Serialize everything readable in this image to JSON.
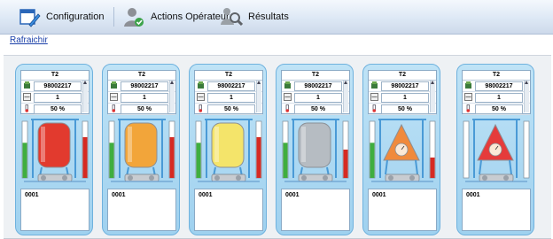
{
  "toolbar": {
    "tabs": [
      {
        "label": "Configuration",
        "icon": "configuration-icon"
      },
      {
        "label": "Actions Opérateur",
        "icon": "operator-icon"
      },
      {
        "label": "Résultats",
        "icon": "search-results-icon"
      }
    ]
  },
  "refresh_label": "Rafraichir",
  "tanks": [
    {
      "title": "T2",
      "lot": "98002217",
      "count": "1",
      "percent": "50 %",
      "code": "0001",
      "shape": "cylinder",
      "color": "#e23a2e",
      "left_level": 0.62,
      "right_level": 0.72
    },
    {
      "title": "T2",
      "lot": "98002217",
      "count": "1",
      "percent": "50 %",
      "code": "0001",
      "shape": "cylinder",
      "color": "#f2a53a",
      "left_level": 0.62,
      "right_level": 0.72
    },
    {
      "title": "T2",
      "lot": "98002217",
      "count": "1",
      "percent": "50 %",
      "code": "0001",
      "shape": "cylinder",
      "color": "#f4e46a",
      "left_level": 0.62,
      "right_level": 0.72
    },
    {
      "title": "T2",
      "lot": "98002217",
      "count": "1",
      "percent": "50 %",
      "code": "0001",
      "shape": "cylinder",
      "color": "#b6bcc2",
      "left_level": 0.62,
      "right_level": 0.5
    },
    {
      "title": "T2",
      "lot": "98002217",
      "count": "1",
      "percent": "50 %",
      "code": "0001",
      "shape": "cone",
      "color": "#f08a3c",
      "left_level": 0.62,
      "right_level": 0.36
    },
    {
      "title": "T2",
      "lot": "98002217",
      "count": "1",
      "percent": "50 %",
      "code": "0001",
      "shape": "cone",
      "color": "#e53b3b",
      "left_level": 0.0,
      "right_level": 0.0
    }
  ]
}
